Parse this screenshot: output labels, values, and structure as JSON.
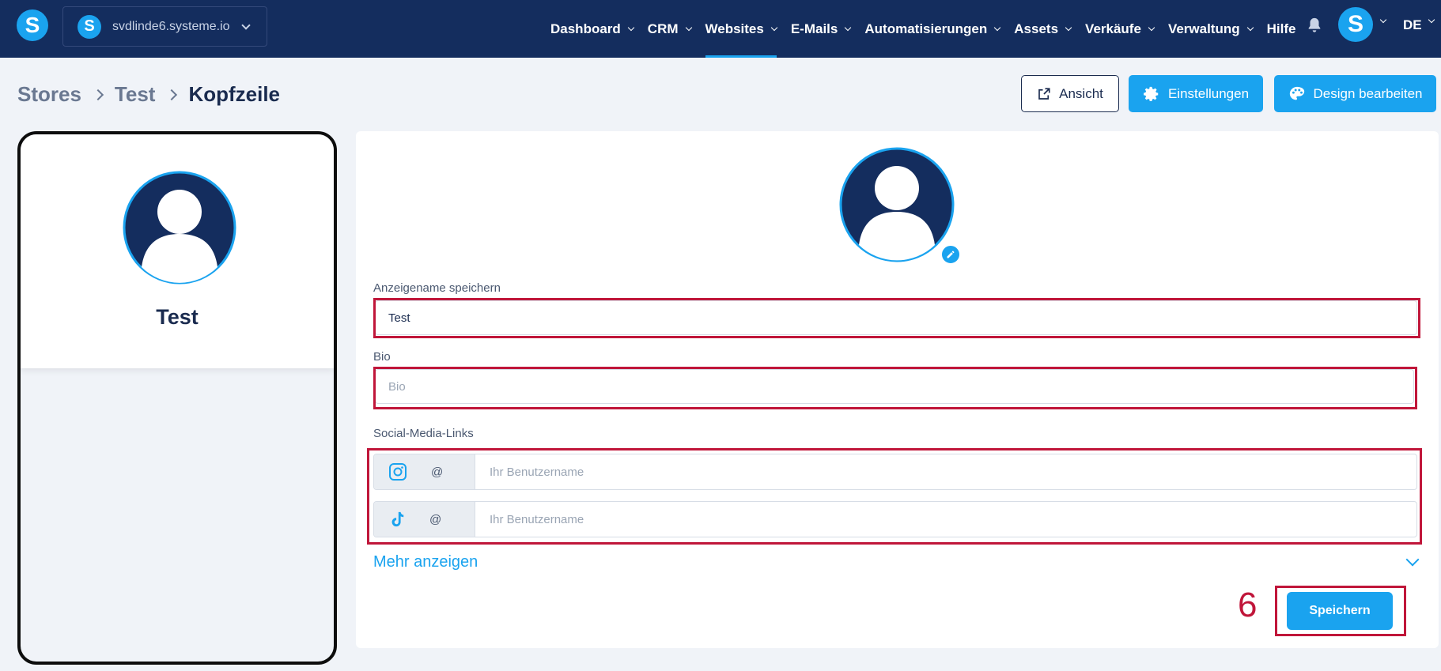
{
  "topbar": {
    "logo_letter": "S",
    "site": {
      "icon_letter": "S",
      "name": "svdlinde6.systeme.io"
    },
    "nav": [
      {
        "label": "Dashboard",
        "has_dropdown": true,
        "active": false
      },
      {
        "label": "CRM",
        "has_dropdown": true,
        "active": false
      },
      {
        "label": "Websites",
        "has_dropdown": true,
        "active": true
      },
      {
        "label": "E-Mails",
        "has_dropdown": true,
        "active": false
      },
      {
        "label": "Automatisierungen",
        "has_dropdown": true,
        "active": false
      },
      {
        "label": "Assets",
        "has_dropdown": true,
        "active": false
      },
      {
        "label": "Verkäufe",
        "has_dropdown": true,
        "active": false
      },
      {
        "label": "Verwaltung",
        "has_dropdown": true,
        "active": false
      },
      {
        "label": "Hilfe",
        "has_dropdown": false,
        "active": false
      }
    ],
    "user_letter": "S",
    "language": "DE"
  },
  "breadcrumb": [
    "Stores",
    "Test",
    "Kopfzeile"
  ],
  "actions": {
    "view_label": "Ansicht",
    "settings_label": "Einstellungen",
    "design_label": "Design bearbeiten"
  },
  "preview": {
    "name": "Test"
  },
  "form": {
    "display_name_label": "Anzeigename speichern",
    "display_name_value": "Test",
    "bio_label": "Bio",
    "bio_placeholder": "Bio",
    "social_label": "Social-Media-Links",
    "social": [
      {
        "icon": "instagram-icon",
        "prefix": "@",
        "placeholder": "Ihr Benutzername"
      },
      {
        "icon": "tiktok-icon",
        "prefix": "@",
        "placeholder": "Ihr Benutzername"
      }
    ],
    "more_label": "Mehr anzeigen",
    "save_label": "Speichern"
  },
  "annotation": {
    "step_number": "6"
  },
  "colors": {
    "nav_bg": "#142d5e",
    "accent": "#1aa3ef",
    "annotation_red": "#c0163a",
    "text_dark": "#1a2b4f"
  }
}
